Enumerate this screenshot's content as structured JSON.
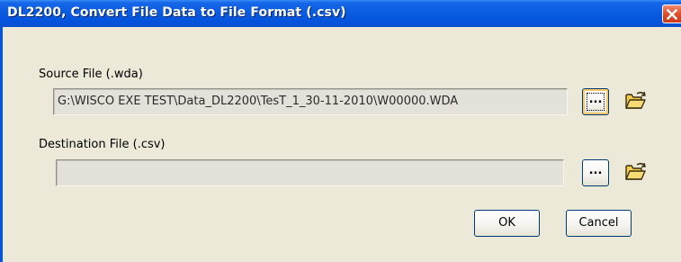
{
  "window": {
    "title": "DL2200, Convert File Data to File Format (.csv)"
  },
  "source": {
    "label": "Source File (.wda)",
    "value": "G:\\WISCO EXE TEST\\Data_DL2200\\TesT_1_30-11-2010\\W00000.WDA",
    "browse_label": "...",
    "folder_icon": "open-folder-icon"
  },
  "destination": {
    "label": "Destination File (.csv)",
    "value": "",
    "browse_label": "...",
    "folder_icon": "open-folder-icon"
  },
  "buttons": {
    "ok_label": "OK",
    "cancel_label": "Cancel"
  },
  "colors": {
    "titlebar": "#0054e3",
    "dialog_face": "#ece9d8",
    "close_button": "#e0532e",
    "disabled_field": "#e3e1d9"
  }
}
